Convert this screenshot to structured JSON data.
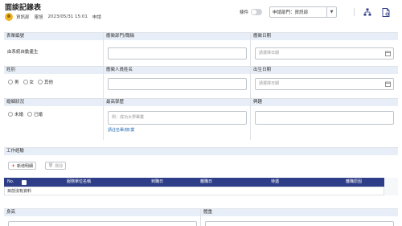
{
  "header": {
    "title": "面談記錄表",
    "user_dept": "資訊部",
    "user_name": "靈旭",
    "timestamp": "2023/05/31 15:01",
    "status": "申請",
    "condition_label": "條件",
    "dept_select_value": "申請部門：資訊部"
  },
  "form": {
    "row1": {
      "form_no_label": "表單編號",
      "form_no_value": "由系統自動產生",
      "dept_title_label": "應徵部門/職稱",
      "apply_date_label": "應徵日期",
      "apply_date_placeholder": "請選擇日期"
    },
    "row2": {
      "gender_label": "姓別",
      "gender_options": [
        "男",
        "女",
        "其他"
      ],
      "applicant_name_label": "應徵人員姓名",
      "birth_date_label": "出生日期",
      "birth_date_placeholder": "請選擇日期"
    },
    "row3": {
      "marital_label": "婚姻狀況",
      "marital_options": [
        "未婚",
        "已婚"
      ],
      "education_label": "最高學歷",
      "education_placeholder": "例：成功大學畢業",
      "education_links": "請註名畢/肄/業",
      "interests_label": "興趣"
    }
  },
  "work": {
    "section_label": "工作經驗",
    "add_button": "新增明細",
    "delete_button": "刪除",
    "columns": [
      "No.",
      "",
      "",
      "服務單位名稱",
      "到職日",
      "離職日",
      "待遇",
      "離職原因"
    ],
    "empty_text": "目前沒有資料"
  },
  "bottom": {
    "height_label": "身高",
    "weight_label": "體重"
  },
  "colors": {
    "label_bg": "#e8eef7",
    "grid_header": "#2e3d87",
    "link": "#2a6fb8",
    "accent_red": "#d9534f"
  }
}
